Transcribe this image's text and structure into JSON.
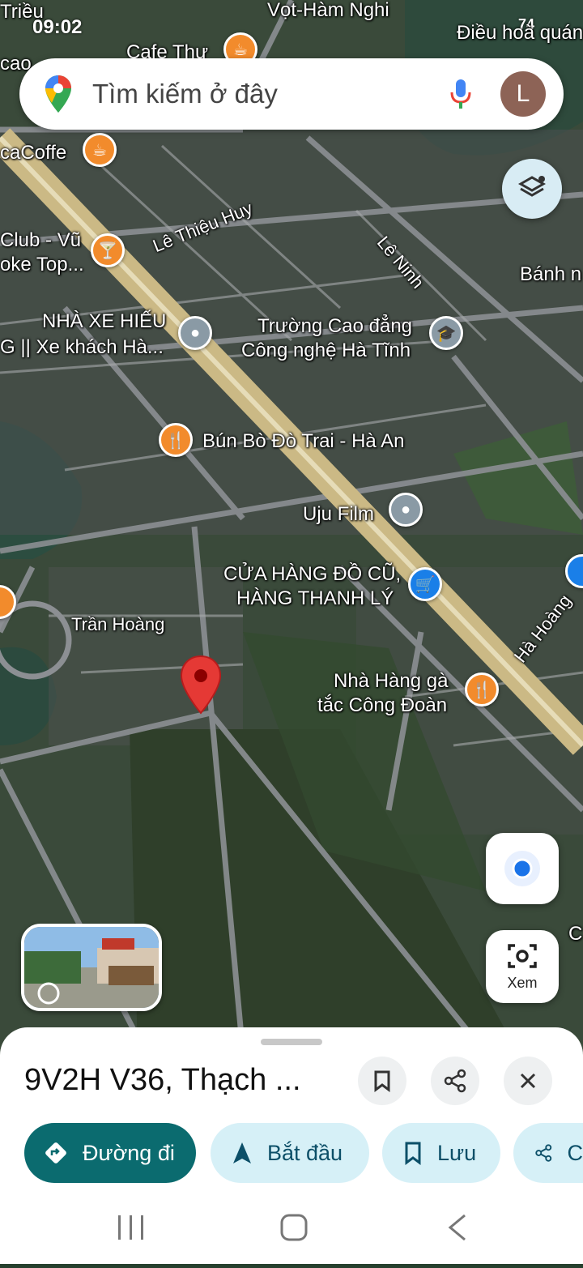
{
  "status_bar": {
    "time": "09:02",
    "battery": "74"
  },
  "search": {
    "placeholder": "Tìm kiếm ở đây",
    "avatar_letter": "L"
  },
  "map": {
    "labels": {
      "trieu": "Triều",
      "vot_ham_nghi": "Vọt-Hàm Nghi",
      "dieu_hoa_quan": "Điều hoà quán",
      "cafe_thu": "Cafe Thư",
      "cao": "cao",
      "hu": "hư",
      "ca_coffe": "caCoffe",
      "club_vu": "Club - Vũ",
      "oke_top": "oke Top...",
      "le_thieu_huy": "Lê Thiệu Huy",
      "le_ninh": "Lê Ninh",
      "banh": "Bánh n",
      "nha_xe_1": "NHÀ XE HIẾU",
      "nha_xe_2": "G || Xe khách Hà...",
      "truong_1": "Trường Cao đẳng",
      "truong_2": "Công nghệ Hà Tĩnh",
      "bun_bo": "Bún Bò Đò Trai - Hà An",
      "uju_film": "Uju Film",
      "cua_hang_1": "CỬA HÀNG ĐỒ CŨ,",
      "cua_hang_2": "HÀNG THANH LÝ",
      "tran_hoang": "Trần Hoàng",
      "ha_hoang": "Hà Hoàng",
      "nha_hang_1": "Nhà Hàng gà",
      "nha_hang_2": "tắc Công Đoàn",
      "c_edge": "C"
    }
  },
  "controls": {
    "lens_label": "Xem"
  },
  "place": {
    "title": "9V2H V36, Thạch ...",
    "chips": {
      "directions": "Đường đi",
      "start": "Bắt đầu",
      "save": "Lưu",
      "share": "C"
    }
  },
  "colors": {
    "primary": "#0b6b6f",
    "secondary_chip": "#d6f0f7",
    "pin_orange": "#f28b2c",
    "marker_red": "#e53935"
  }
}
